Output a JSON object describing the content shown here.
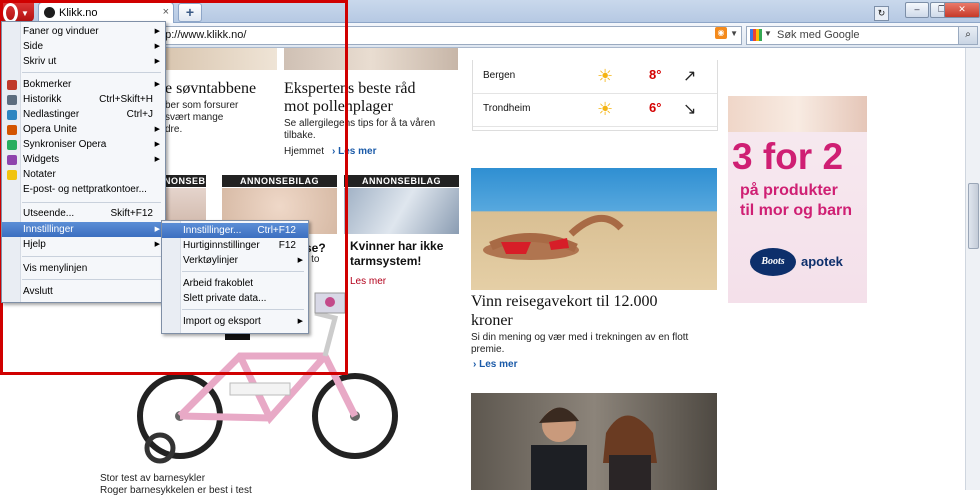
{
  "browser": {
    "tab_title": "Klikk.no",
    "tab_close": "×",
    "newtab": "+",
    "url": "ttp://www.klikk.no/",
    "search_placeholder": "Søk med Google",
    "window_controls": [
      "–",
      "❐",
      "✕"
    ]
  },
  "opera_menu": {
    "items": [
      {
        "label": "Faner og vinduer",
        "submenu": true
      },
      {
        "label": "Side",
        "submenu": true
      },
      {
        "label": "Skriv ut",
        "submenu": true
      },
      {
        "label": "Bokmerker",
        "submenu": true,
        "icon": "bookmarks-icon"
      },
      {
        "label": "Historikk",
        "shortcut": "Ctrl+Skift+H",
        "icon": "history-icon"
      },
      {
        "label": "Nedlastinger",
        "shortcut": "Ctrl+J",
        "icon": "downloads-icon"
      },
      {
        "label": "Opera Unite",
        "submenu": true,
        "icon": "unite-icon"
      },
      {
        "label": "Synkroniser Opera",
        "submenu": true,
        "icon": "sync-icon"
      },
      {
        "label": "Widgets",
        "submenu": true,
        "icon": "widgets-icon"
      },
      {
        "label": "Notater",
        "icon": "notes-icon"
      },
      {
        "label": "E-post- og nettpratkontoer..."
      },
      {
        "label": "Utseende...",
        "shortcut": "Skift+F12"
      },
      {
        "label": "Innstillinger",
        "submenu": true,
        "highlight": true
      },
      {
        "label": "Hjelp",
        "submenu": true
      },
      {
        "label": "Vis menylinjen"
      },
      {
        "label": "Avslutt"
      }
    ]
  },
  "settings_submenu": {
    "items": [
      {
        "label": "Innstillinger...",
        "shortcut": "Ctrl+F12",
        "highlight": true
      },
      {
        "label": "Hurtiginnstillinger",
        "shortcut": "F12"
      },
      {
        "label": "Verktøylinjer",
        "submenu": true
      },
      {
        "label": "Arbeid frakoblet"
      },
      {
        "label": "Slett private data..."
      },
      {
        "label": "Import og eksport",
        "submenu": true
      }
    ]
  },
  "page": {
    "article1": {
      "title": "e søvntabbene",
      "body1": "ber som forsurer",
      "body2": "svært mange",
      "body3": "dre."
    },
    "article2": {
      "title1": "Ekspertens beste råd",
      "title2": "mot pollenplager",
      "body1": "Se allergilegens tips for å ta våren",
      "body2": "tilbake.",
      "link_home": "Hjemmet",
      "link_more": "› Les mer"
    },
    "annonse_label": "ANNONSEBILAG",
    "article3": {
      "title": "se?",
      "body": "r to"
    },
    "article4": {
      "title1": "Kvinner har ikke",
      "title2": "tarmsystem!",
      "more": "Les mer"
    },
    "weather": [
      {
        "city": "Bergen",
        "temp": "8°",
        "icon": "partly-sunny-icon",
        "wind": "↗"
      },
      {
        "city": "Trondheim",
        "temp": "6°",
        "icon": "sun-icon",
        "wind": "↘"
      }
    ],
    "article5": {
      "title1": "Vinn reisegavekort til 12.000",
      "title2": "kroner",
      "body1": "Si din mening og vær med i trekningen av en flott",
      "body2": "premie.",
      "more": "› Les mer"
    },
    "article6": {
      "caption1": "Stor test av barnesykler",
      "caption2": "Roger barnesykkelen er best i test"
    },
    "ad": {
      "headline": "3 for 2",
      "line1": "på produkter",
      "line2": "til mor og barn",
      "brand": "Boots",
      "brand2": "apotek"
    }
  },
  "colors": {
    "highlight_box": "#d00000",
    "menu_highlight": "#3c6fc0",
    "ad_pink": "#cf1f73"
  }
}
